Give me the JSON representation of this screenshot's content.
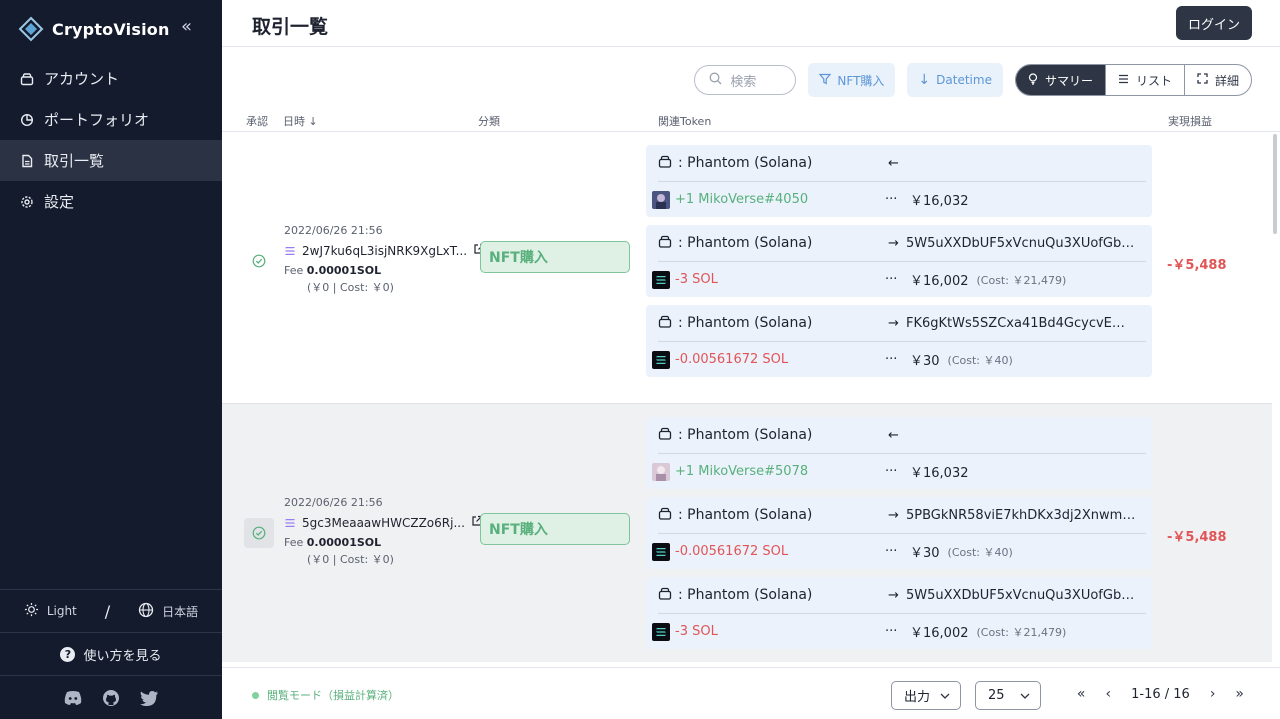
{
  "sidebar": {
    "brand": "CryptoVision",
    "collapse_icon": "double-chevron-left-icon",
    "items": [
      {
        "label": "アカウント",
        "icon": "wallet-icon",
        "active": false
      },
      {
        "label": "ポートフォリオ",
        "icon": "pie-chart-icon",
        "active": false
      },
      {
        "label": "取引一覧",
        "icon": "document-icon",
        "active": true
      },
      {
        "label": "設定",
        "icon": "gear-icon",
        "active": false
      }
    ],
    "theme_label": "Light",
    "separator": "/",
    "language_label": "日本語",
    "help_label": "使い方を見る",
    "social": [
      "discord-icon",
      "github-icon",
      "twitter-icon"
    ]
  },
  "header": {
    "title": "取引一覧",
    "login_label": "ログイン"
  },
  "toolbar": {
    "search_placeholder": "検索",
    "filter_label": "NFT購入",
    "sort_label": "Datetime",
    "views": [
      {
        "label": "サマリー",
        "icon": "bulb-icon",
        "active": true
      },
      {
        "label": "リスト",
        "icon": "list-icon",
        "active": false
      },
      {
        "label": "詳細",
        "icon": "expand-icon",
        "active": false
      }
    ]
  },
  "table": {
    "headers": {
      "approve": "承認",
      "datetime": "日時 ↓",
      "category": "分類",
      "tokens": "関連Token",
      "pnl": "実現損益"
    },
    "transactions": [
      {
        "date": "2022/06/26 21:56",
        "hash": "2wJ7ku6qL3isjNRK9XgLxT...",
        "fee_label": "Fee",
        "fee_value": "0.00001SOL",
        "fee_cost": "(￥0 | Cost: ￥0)",
        "category": "NFT購入",
        "pnl": "-￥5,488",
        "tokens": [
          {
            "wallet": ": Phantom (Solana)",
            "arrow": "←",
            "counterparty": "",
            "thumb": "nft-a",
            "amount": "+1 MikoVerse#4050",
            "sign": "plus",
            "dots": "···",
            "value": "￥16,032",
            "cost": ""
          },
          {
            "wallet": ": Phantom (Solana)",
            "arrow": "→",
            "counterparty": "5W5uXXDbUF5xVcnuQu3XUofGb7t...",
            "thumb": "sol",
            "amount": "-3 SOL",
            "sign": "minus",
            "dots": "···",
            "value": "￥16,002",
            "cost": "(Cost: ￥21,479)"
          },
          {
            "wallet": ": Phantom (Solana)",
            "arrow": "→",
            "counterparty": "FK6gKtWs5SZCxa41Bd4GcycvEMEi...",
            "thumb": "sol",
            "amount": "-0.00561672 SOL",
            "sign": "minus",
            "dots": "···",
            "value": "￥30",
            "cost": "(Cost: ￥40)"
          }
        ]
      },
      {
        "date": "2022/06/26 21:56",
        "hash": "5gc3MeaaawHWCZZo6Rj...",
        "fee_label": "Fee",
        "fee_value": "0.00001SOL",
        "fee_cost": "(￥0 | Cost: ￥0)",
        "category": "NFT購入",
        "pnl": "-￥5,488",
        "tokens": [
          {
            "wallet": ": Phantom (Solana)",
            "arrow": "←",
            "counterparty": "",
            "thumb": "nft-b",
            "amount": "+1 MikoVerse#5078",
            "sign": "plus",
            "dots": "···",
            "value": "￥16,032",
            "cost": ""
          },
          {
            "wallet": ": Phantom (Solana)",
            "arrow": "→",
            "counterparty": "5PBGkNR58viE7khDKx3dj2Xnwm6...",
            "thumb": "sol",
            "amount": "-0.00561672 SOL",
            "sign": "minus",
            "dots": "···",
            "value": "￥30",
            "cost": "(Cost: ￥40)"
          },
          {
            "wallet": ": Phantom (Solana)",
            "arrow": "→",
            "counterparty": "5W5uXXDbUF5xVcnuQu3XUofGb7t...",
            "thumb": "sol",
            "amount": "-3 SOL",
            "sign": "minus",
            "dots": "···",
            "value": "￥16,002",
            "cost": "(Cost: ￥21,479)"
          }
        ]
      }
    ]
  },
  "footer": {
    "mode_label": "閲覧モード（損益計算済）",
    "export_label": "出力",
    "page_size": "25",
    "page_info": "1-16 / 16"
  },
  "colors": {
    "sidebar_bg": "#141b2d",
    "positive": "#58b07c",
    "negative": "#e05557",
    "accent_blue": "#5d96d7",
    "token_card_bg": "#ebf2fb"
  }
}
